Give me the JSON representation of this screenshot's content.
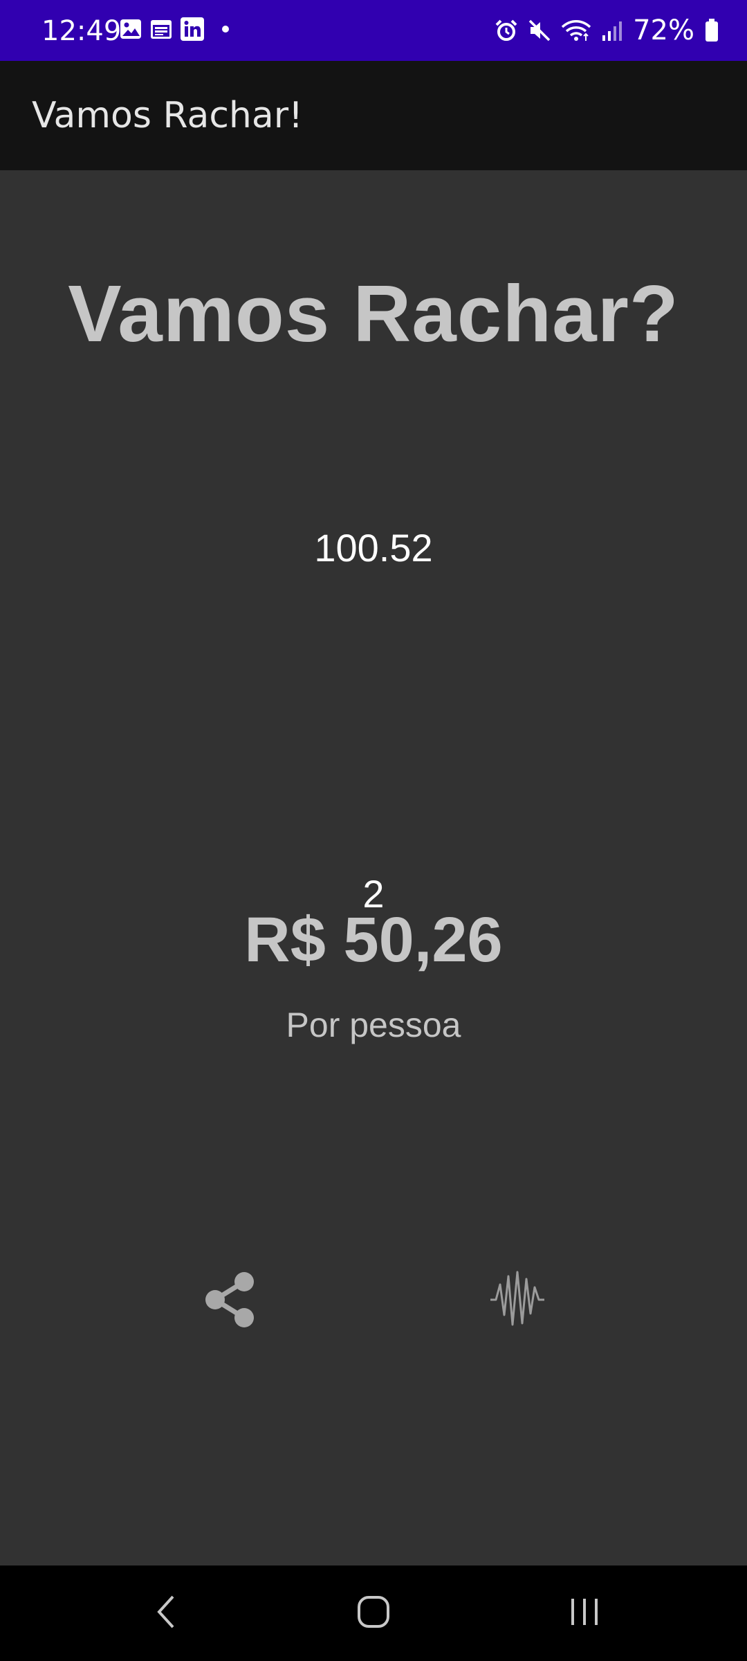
{
  "status_bar": {
    "time": "12:49",
    "battery": "72%",
    "left_icons": [
      "image-icon",
      "calendar-icon",
      "linkedin-icon",
      "dot-icon"
    ],
    "right_icons": [
      "alarm-icon",
      "mute-icon",
      "wifi-icon",
      "signal-icon",
      "battery-icon"
    ],
    "background": "#3100b0"
  },
  "app_bar": {
    "title": "Vamos Rachar!"
  },
  "main": {
    "headline": "Vamos Rachar?",
    "bill_value": "100.52",
    "people_value": "2",
    "result_amount": "R$ 50,26",
    "result_caption": "Por pessoa",
    "actions": [
      "share-icon",
      "audio-wave-icon"
    ]
  },
  "nav_bar": {
    "buttons": [
      "back-icon",
      "home-icon",
      "recents-icon"
    ]
  },
  "colors": {
    "background": "#323232",
    "app_bar": "#131313",
    "text_muted": "#c6c6c6",
    "text_white": "#ffffff"
  }
}
